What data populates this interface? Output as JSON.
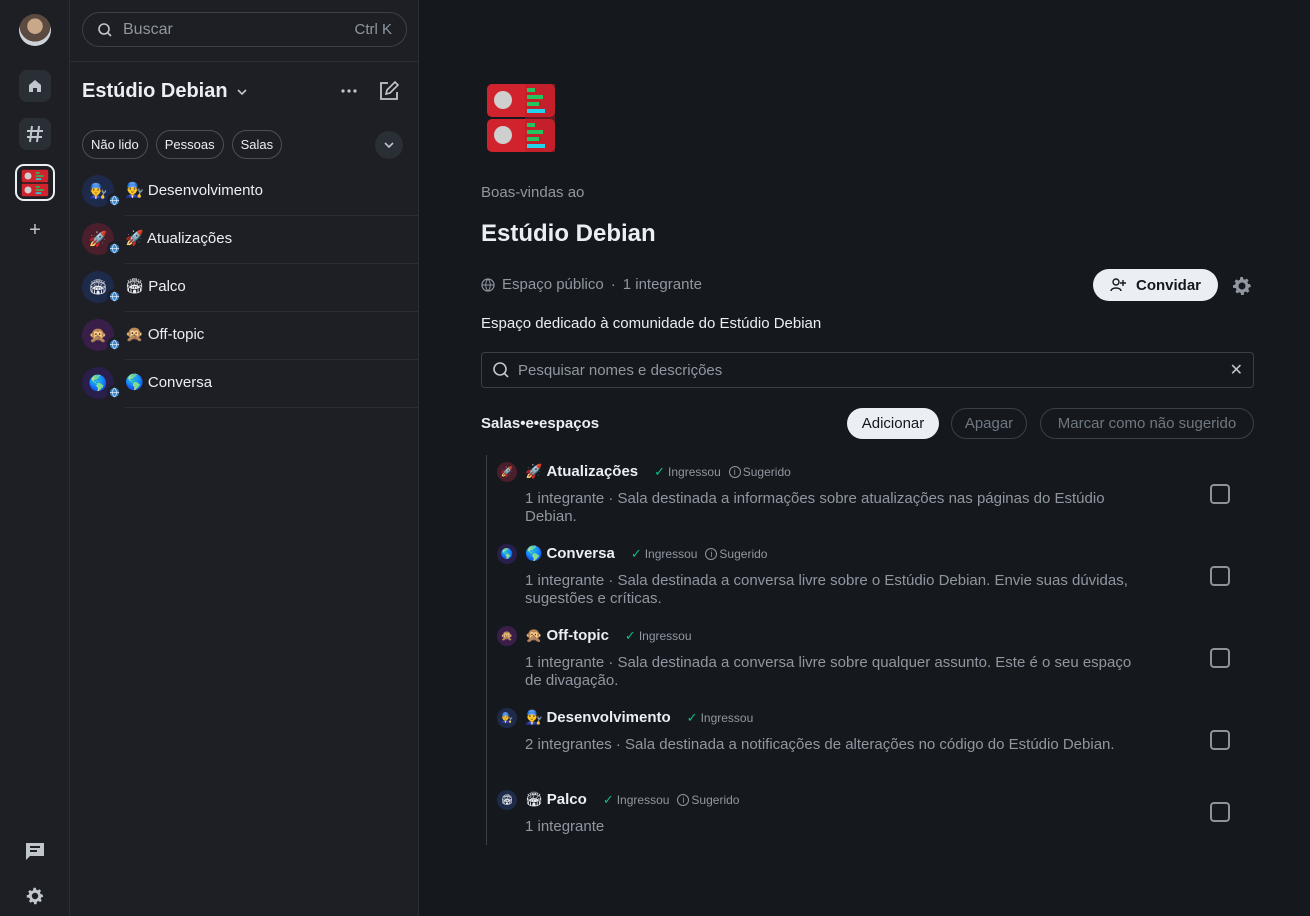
{
  "search": {
    "placeholder": "Buscar",
    "shortcut": "Ctrl K"
  },
  "roomlist": {
    "title": "Estúdio Debian",
    "filters": [
      "Não lido",
      "Pessoas",
      "Salas"
    ],
    "rooms": [
      {
        "emoji": "👨‍🔧",
        "label": "Desenvolvimento",
        "color": "#1e2a4a"
      },
      {
        "emoji": "🚀",
        "label": "Atualizações",
        "color": "#4a1e2a"
      },
      {
        "emoji": "🏟",
        "label": "Palco",
        "color": "#1e2a4a"
      },
      {
        "emoji": "🙊",
        "label": "Off-topic",
        "color": "#3a1e4a"
      },
      {
        "emoji": "🌎",
        "label": "Conversa",
        "color": "#2a1e4a"
      }
    ]
  },
  "space": {
    "welcome": "Boas-vindas ao",
    "name": "Estúdio Debian",
    "visibility": "Espaço público",
    "dot": "·",
    "members": "1 integrante",
    "invite_label": "Convidar",
    "description": "Espaço dedicado à comunidade do Estúdio Debian",
    "filter_placeholder": "Pesquisar nomes e descrições",
    "section_title": "Salas•e•espaços",
    "add_label": "Adicionar",
    "delete_label": "Apagar",
    "mark_label": "Marcar como não sugerido"
  },
  "entries": [
    {
      "emoji": "🚀",
      "name": "Atualizações",
      "joined": "Ingressou",
      "suggested": "Sugerido",
      "desc": "1 integrante · Sala destinada a informações sobre atualizações nas páginas do Estúdio Debian.",
      "color": "#4a1e2a"
    },
    {
      "emoji": "🌎",
      "name": "Conversa",
      "joined": "Ingressou",
      "suggested": "Sugerido",
      "desc": "1 integrante · Sala destinada a conversa livre sobre o Estúdio Debian. Envie suas dúvidas, sugestões e críticas.",
      "color": "#2a1e4a"
    },
    {
      "emoji": "🙊",
      "name": "Off-topic",
      "joined": "Ingressou",
      "suggested": "",
      "desc": "1 integrante · Sala destinada a conversa livre sobre qualquer assunto. Este é o seu espaço de divagação.",
      "color": "#3a1e4a"
    },
    {
      "emoji": "👨‍🔧",
      "name": "Desenvolvimento",
      "joined": "Ingressou",
      "suggested": "",
      "desc": "2 integrantes · Sala destinada a notificações de alterações no código do Estúdio Debian.",
      "color": "#1e2a4a"
    },
    {
      "emoji": "🏟",
      "name": "Palco",
      "joined": "Ingressou",
      "suggested": "Sugerido",
      "desc": "1 integrante",
      "color": "#1e2a4a"
    }
  ],
  "icons": {
    "home": "home-icon",
    "rooms": "hash-icon",
    "add_space": "plus-icon",
    "threads": "threads-icon",
    "settings": "settings-icon"
  },
  "colors": {
    "accent": "#0dbd8b",
    "background": "#15191e",
    "panel": "#1d1f24"
  }
}
